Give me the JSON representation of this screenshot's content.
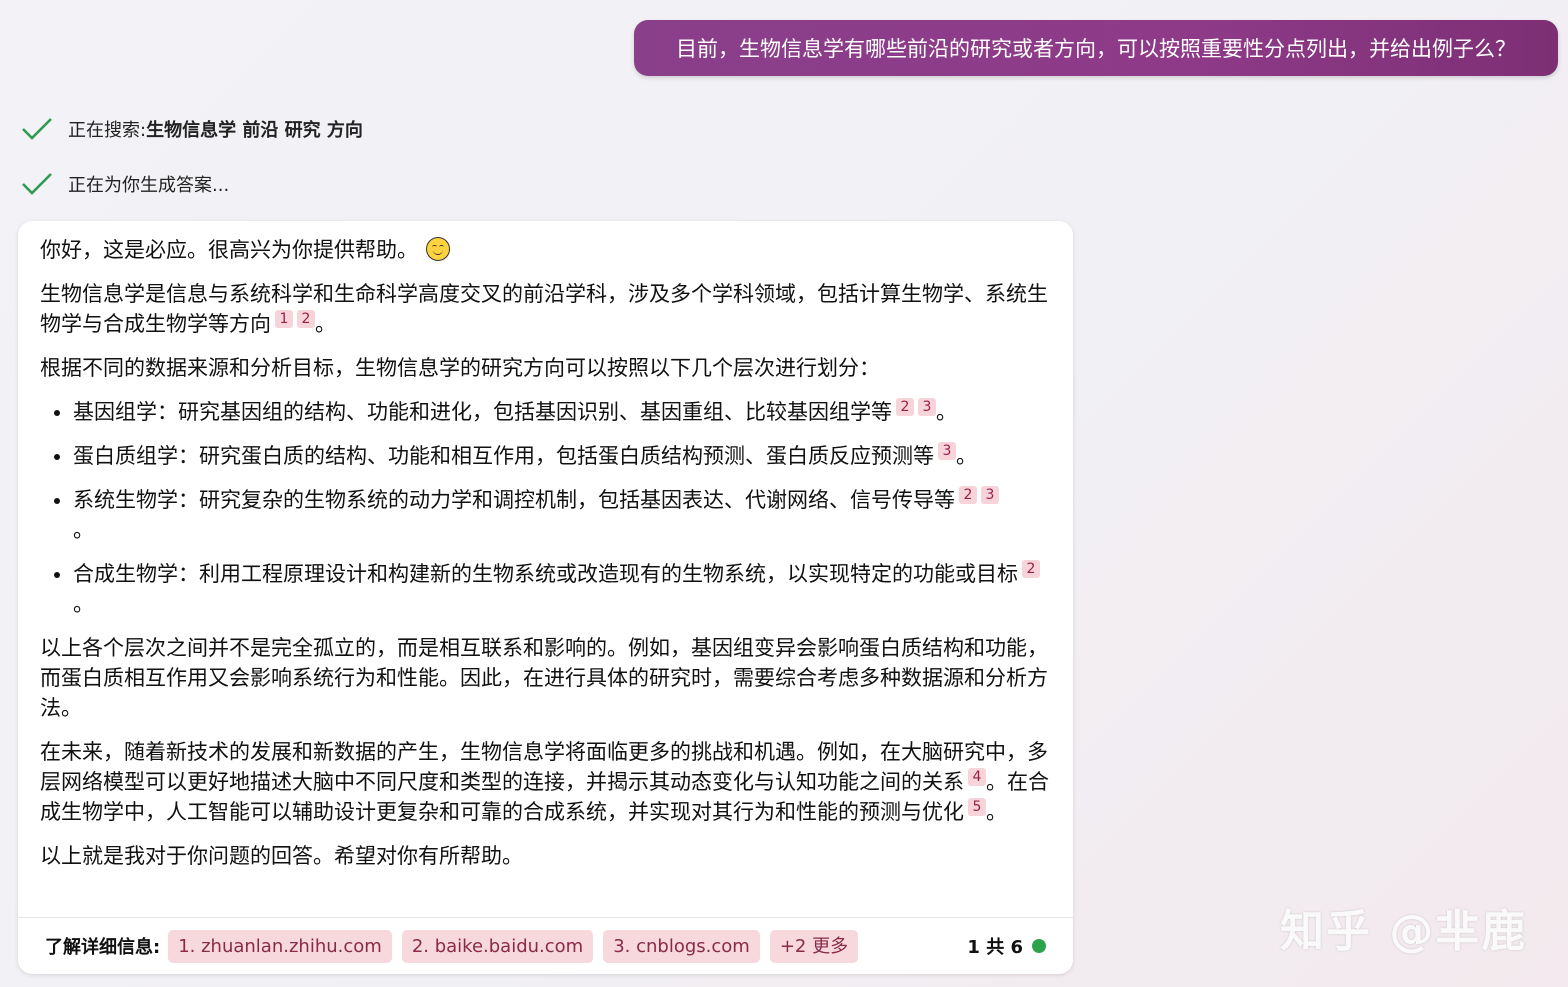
{
  "user_message": "目前，生物信息学有哪些前沿的研究或者方向，可以按照重要性分点列出，并给出例子么？",
  "status": {
    "searching_label": "正在搜索: ",
    "searching_query": "生物信息学 前沿 研究 方向",
    "generating_label": "正在为你生成答案..."
  },
  "answer": {
    "greeting": "你好，这是必应。很高兴为你提供帮助。",
    "intro_text": "生物信息学是信息与系统科学和生命科学高度交叉的前沿学科，涉及多个学科领域，包括计算生物学、系统生物学与合成生物学等方向",
    "intro_cites": [
      "1",
      "2"
    ],
    "division_text": "根据不同的数据来源和分析目标，生物信息学的研究方向可以按照以下几个层次进行划分：",
    "bullets": [
      {
        "text": "基因组学：研究基因组的结构、功能和进化，包括基因识别、基因重组、比较基因组学等",
        "cites": [
          "2",
          "3"
        ]
      },
      {
        "text": "蛋白质组学：研究蛋白质的结构、功能和相互作用，包括蛋白质结构预测、蛋白质反应预测等",
        "cites": [
          "3"
        ]
      },
      {
        "text": "系统生物学：研究复杂的生物系统的动力学和调控机制，包括基因表达、代谢网络、信号传导等",
        "cites": [
          "2",
          "3"
        ]
      },
      {
        "text": "合成生物学：利用工程原理设计和构建新的生物系统或改造现有的生物系统，以实现特定的功能或目标",
        "cites": [
          "2"
        ]
      }
    ],
    "relation_text": "以上各个层次之间并不是完全孤立的，而是相互联系和影响的。例如，基因组变异会影响蛋白质结构和功能，而蛋白质相互作用又会影响系统行为和性能。因此，在进行具体的研究时，需要综合考虑多种数据源和分析方法。",
    "future_text_1": "在未来，随着新技术的发展和新数据的产生，生物信息学将面临更多的挑战和机遇。例如，在大脑研究中，多层网络模型可以更好地描述大脑中不同尺度和类型的连接，并揭示其动态变化与认知功能之间的关系",
    "future_cite_1": "4",
    "future_text_2": "。在合成生物学中，人工智能可以辅助设计更复杂和可靠的合成系统，并实现对其行为和性能的预测与优化",
    "future_cite_2": "5",
    "closing": "以上就是我对于你问题的回答。希望对你有所帮助。",
    "period": "。"
  },
  "footer": {
    "learn_more_label": "了解详细信息:",
    "sources": [
      "1. zhuanlan.zhihu.com",
      "2. baike.baidu.com",
      "3. cnblogs.com"
    ],
    "more": "+2 更多",
    "counter": "1 共 6",
    "status_color": "#2aa34a"
  },
  "watermark": "知乎 @芈鹿"
}
